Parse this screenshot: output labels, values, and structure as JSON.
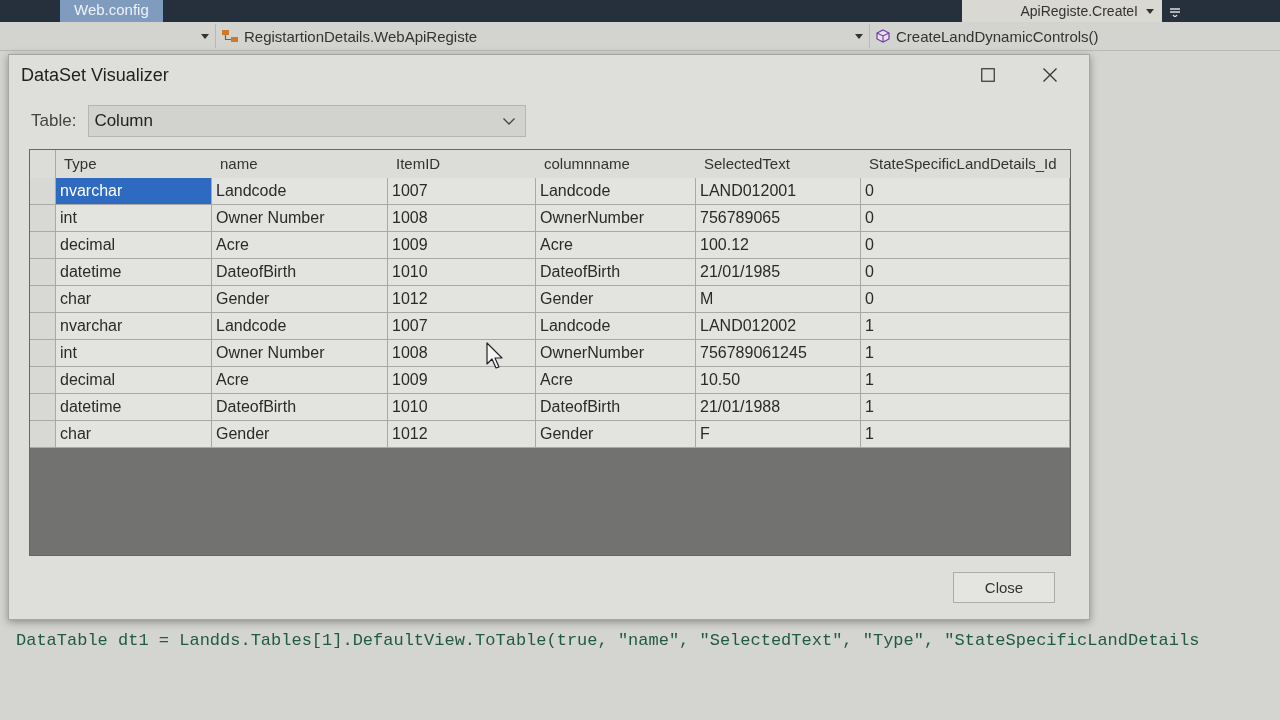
{
  "ide": {
    "file_tab": "Web.config",
    "member_dropdown": "ApiRegiste.CreateI",
    "navigation": {
      "type_dropdown": "RegistartionDetails.WebApiRegiste",
      "method_dropdown": "CreateLandDynamicControls()"
    }
  },
  "dialog": {
    "title": "DataSet Visualizer",
    "table_label": "Table:",
    "table_select": {
      "value": "Column"
    },
    "grid": {
      "columns": [
        "Type",
        "name",
        "ItemID",
        "columnname",
        "SelectedText",
        "StateSpecificLandDetails_Id"
      ],
      "rows": [
        {
          "cells": [
            {
              "text": "nvarchar",
              "selected": true
            },
            {
              "text": "Landcode",
              "selected": false
            },
            {
              "text": "1007",
              "selected": false
            },
            {
              "text": "Landcode",
              "selected": false
            },
            {
              "text": "LAND012001",
              "selected": false
            },
            {
              "text": "0",
              "selected": false
            }
          ]
        },
        {
          "cells": [
            {
              "text": "int",
              "selected": false
            },
            {
              "text": "Owner Number",
              "selected": false
            },
            {
              "text": "1008",
              "selected": false
            },
            {
              "text": "OwnerNumber",
              "selected": false
            },
            {
              "text": "756789065",
              "selected": false
            },
            {
              "text": "0",
              "selected": false
            }
          ]
        },
        {
          "cells": [
            {
              "text": "decimal",
              "selected": false
            },
            {
              "text": "Acre",
              "selected": false
            },
            {
              "text": "1009",
              "selected": false
            },
            {
              "text": "Acre",
              "selected": false
            },
            {
              "text": "100.12",
              "selected": false
            },
            {
              "text": "0",
              "selected": false
            }
          ]
        },
        {
          "cells": [
            {
              "text": "datetime",
              "selected": false
            },
            {
              "text": "DateofBirth",
              "selected": false
            },
            {
              "text": "1010",
              "selected": false
            },
            {
              "text": "DateofBirth",
              "selected": false
            },
            {
              "text": "21/01/1985",
              "selected": false
            },
            {
              "text": "0",
              "selected": false
            }
          ]
        },
        {
          "cells": [
            {
              "text": "char",
              "selected": false
            },
            {
              "text": "Gender",
              "selected": false
            },
            {
              "text": "1012",
              "selected": false
            },
            {
              "text": "Gender",
              "selected": false
            },
            {
              "text": "M",
              "selected": false
            },
            {
              "text": "0",
              "selected": false
            }
          ]
        },
        {
          "cells": [
            {
              "text": "nvarchar",
              "selected": false
            },
            {
              "text": "Landcode",
              "selected": false
            },
            {
              "text": "1007",
              "selected": false
            },
            {
              "text": "Landcode",
              "selected": false
            },
            {
              "text": "LAND012002",
              "selected": false
            },
            {
              "text": "1",
              "selected": false
            }
          ]
        },
        {
          "cells": [
            {
              "text": "int",
              "selected": false
            },
            {
              "text": "Owner Number",
              "selected": false
            },
            {
              "text": "1008",
              "selected": false
            },
            {
              "text": "OwnerNumber",
              "selected": false
            },
            {
              "text": "756789061245",
              "selected": false
            },
            {
              "text": "1",
              "selected": false
            }
          ]
        },
        {
          "cells": [
            {
              "text": "decimal",
              "selected": false
            },
            {
              "text": "Acre",
              "selected": false
            },
            {
              "text": "1009",
              "selected": false
            },
            {
              "text": "Acre",
              "selected": false
            },
            {
              "text": "10.50",
              "selected": false
            },
            {
              "text": "1",
              "selected": false
            }
          ]
        },
        {
          "cells": [
            {
              "text": "datetime",
              "selected": false
            },
            {
              "text": "DateofBirth",
              "selected": false
            },
            {
              "text": "1010",
              "selected": false
            },
            {
              "text": "DateofBirth",
              "selected": false
            },
            {
              "text": "21/01/1988",
              "selected": false
            },
            {
              "text": "1",
              "selected": false
            }
          ]
        },
        {
          "cells": [
            {
              "text": "char",
              "selected": false
            },
            {
              "text": "Gender",
              "selected": false
            },
            {
              "text": "1012",
              "selected": false
            },
            {
              "text": "Gender",
              "selected": false
            },
            {
              "text": "F",
              "selected": false
            },
            {
              "text": "1",
              "selected": false
            }
          ]
        }
      ]
    },
    "buttons": [
      "Close"
    ]
  },
  "editor": {
    "code_line": "DataTable dt1 = Landds.Tables[1].DefaultView.ToTable(true, \"name\", \"SelectedText\", \"Type\", \"StateSpecificLandDetails"
  }
}
